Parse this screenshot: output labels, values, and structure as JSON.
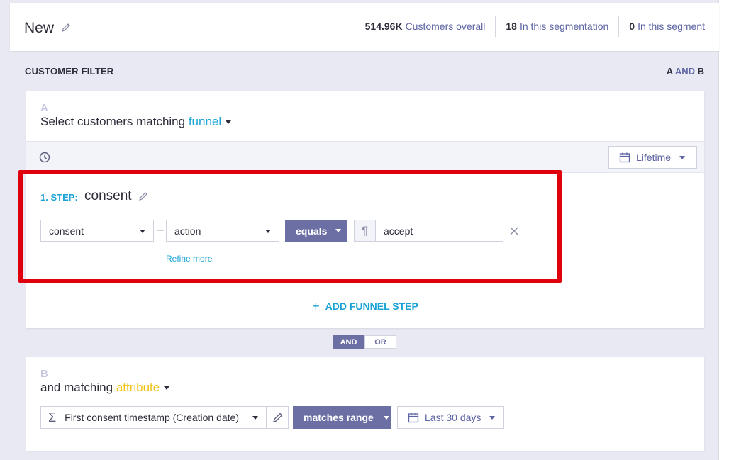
{
  "header": {
    "segment_name": "New",
    "stats": [
      {
        "value": "514.96K",
        "label": "Customers overall"
      },
      {
        "value": "18",
        "label": "In this segmentation"
      },
      {
        "value": "0",
        "label": "In this segment"
      }
    ]
  },
  "filter": {
    "title": "CUSTOMER FILTER",
    "logic": {
      "a": "A",
      "op": "AND",
      "b": "B"
    }
  },
  "card_a": {
    "letter": "A",
    "heading_prefix": "Select customers matching",
    "heading_type": "funnel",
    "timeframe": "Lifetime",
    "step": {
      "label": "1. STEP:",
      "name": "consent",
      "event": "consent",
      "property": "action",
      "operator": "equals",
      "type_icon": "text-type-icon",
      "value": "accept",
      "refine": "Refine more"
    },
    "add_step": "ADD FUNNEL STEP"
  },
  "combinator": {
    "options": [
      "AND",
      "OR"
    ],
    "selected": "AND"
  },
  "card_b": {
    "letter": "B",
    "heading_prefix": "and matching",
    "heading_type": "attribute",
    "attribute": "First consent timestamp (Creation date)",
    "operator": "matches range",
    "range": "Last 30 days"
  },
  "colors": {
    "accent_purple": "#6b6fa3",
    "link_blue": "#1aa3d4",
    "attribute_yellow": "#f0c419",
    "highlight_red": "#e0000d"
  }
}
